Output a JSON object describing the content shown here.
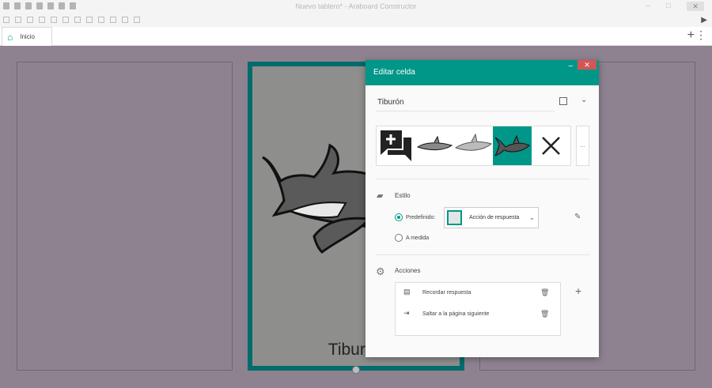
{
  "window": {
    "title": "Nuevo tablero* - Araboard Constructor",
    "min": "–",
    "max": "□",
    "close": "✕"
  },
  "toolbar": {
    "play": "▶"
  },
  "tabs": [
    {
      "label": "Inicio",
      "icon": "home-icon"
    }
  ],
  "tabbar": {
    "add": "+",
    "more": "⋮"
  },
  "board": {
    "cell_caption": "Tiburón"
  },
  "dialog": {
    "title": "Editar celda",
    "minimize": "–",
    "close": "✕",
    "name_value": "Tiburón",
    "more_images": "...",
    "style": {
      "label": "Estilo",
      "predefined_label": "Predefinido:",
      "custom_label": "A medida",
      "selected_style": "Acción de respuesta"
    },
    "actions": {
      "label": "Acciones",
      "items": [
        {
          "label": "Recordar respuesta",
          "icon": "chat-answer-icon"
        },
        {
          "label": "Saltar a la página siguiente",
          "icon": "login-arrow-icon"
        }
      ],
      "add": "+"
    }
  },
  "colors": {
    "accent": "#009688",
    "cell_border": "#006c6c",
    "close": "#d35656"
  }
}
